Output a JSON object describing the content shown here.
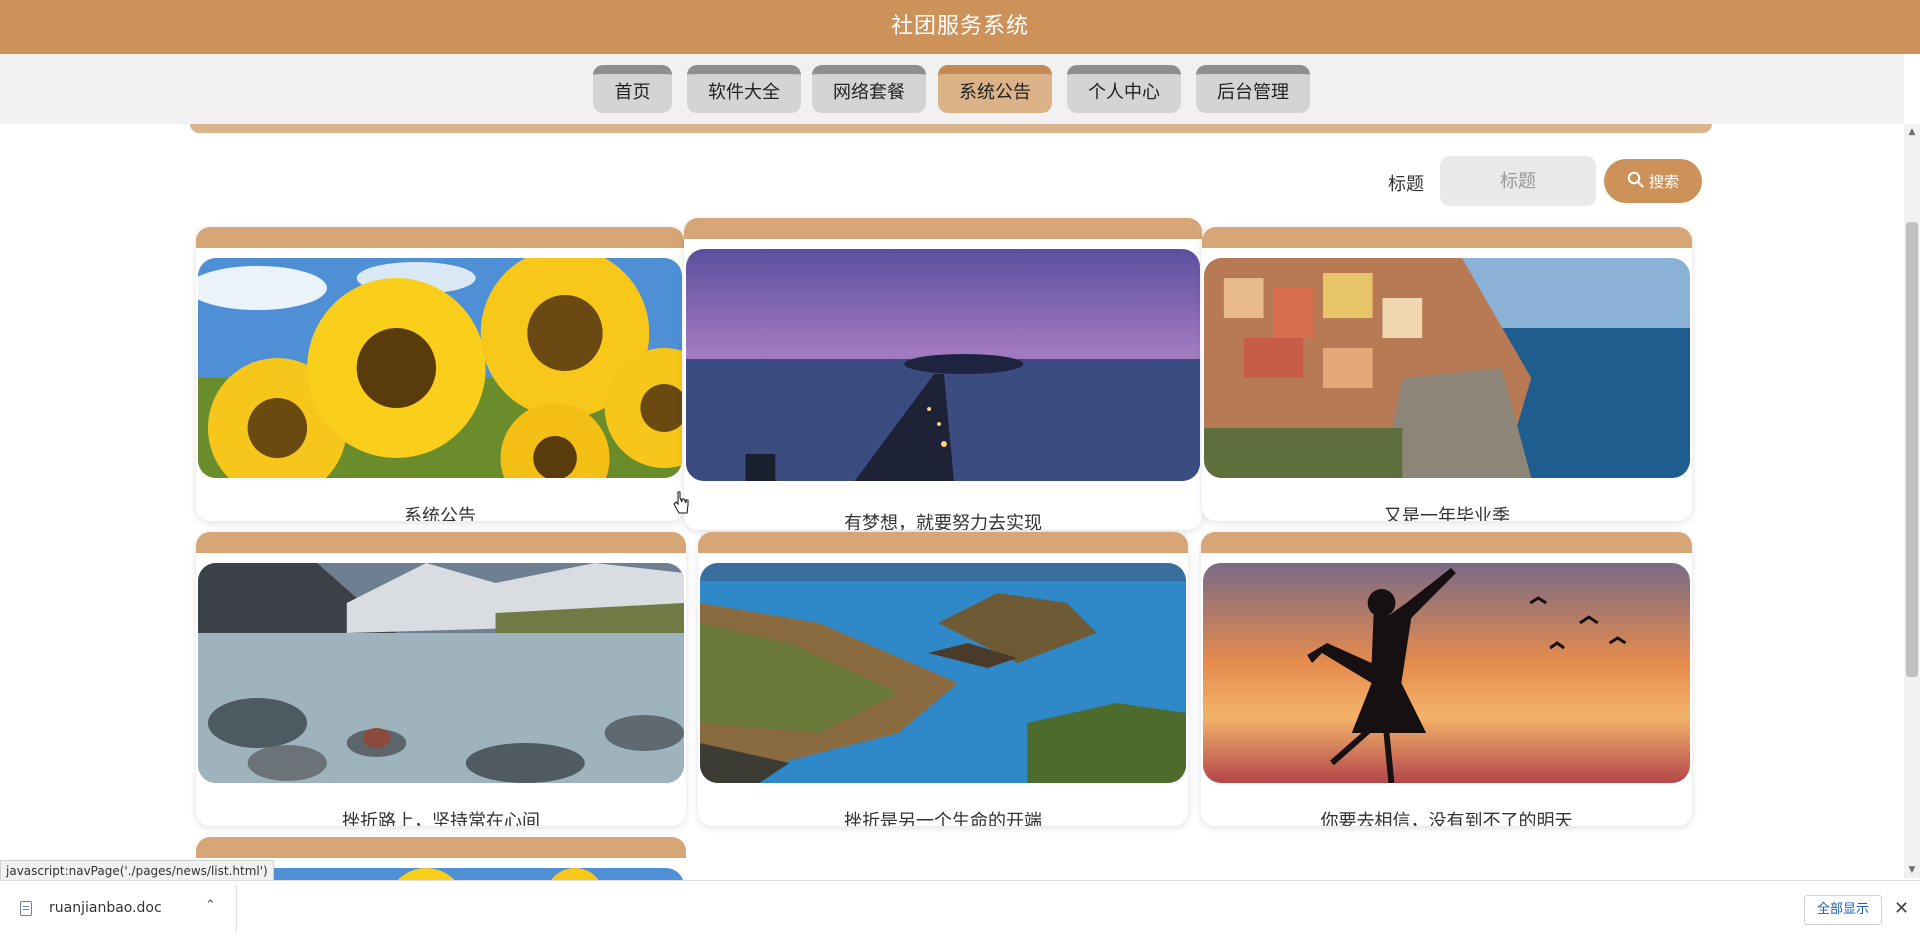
{
  "header": {
    "title": "社团服务系统"
  },
  "nav": {
    "items": [
      {
        "label": "首页"
      },
      {
        "label": "软件大全"
      },
      {
        "label": "网络套餐"
      },
      {
        "label": "系统公告"
      },
      {
        "label": "个人中心"
      },
      {
        "label": "后台管理"
      }
    ],
    "active_index": 3
  },
  "search": {
    "label": "标题",
    "placeholder": "标题",
    "button_label": "搜索"
  },
  "cards": [
    {
      "title": "系统公告",
      "image": "sunflowers"
    },
    {
      "title": "有梦想，就要努力去实现",
      "image": "pier-at-dusk"
    },
    {
      "title": "又是一年毕业季",
      "image": "cliffside-village"
    },
    {
      "title": "挫折路上，坚持常在心间",
      "image": "mountain-river"
    },
    {
      "title": "挫折是另一个生命的开端",
      "image": "lake-island"
    },
    {
      "title": "你要去相信，没有到不了的明天",
      "image": "girl-silhouette-sunset"
    }
  ],
  "status_bar": {
    "url": "javascript:navPage('./pages/news/list.html')"
  },
  "downloads": {
    "file_name": "ruanjianbao.doc",
    "show_all_label": "全部显示"
  },
  "colors": {
    "primary": "#cd9259",
    "card_top": "#d6a677",
    "nav_active": "#dcb389",
    "nav_inactive": "#d4d4d4"
  }
}
